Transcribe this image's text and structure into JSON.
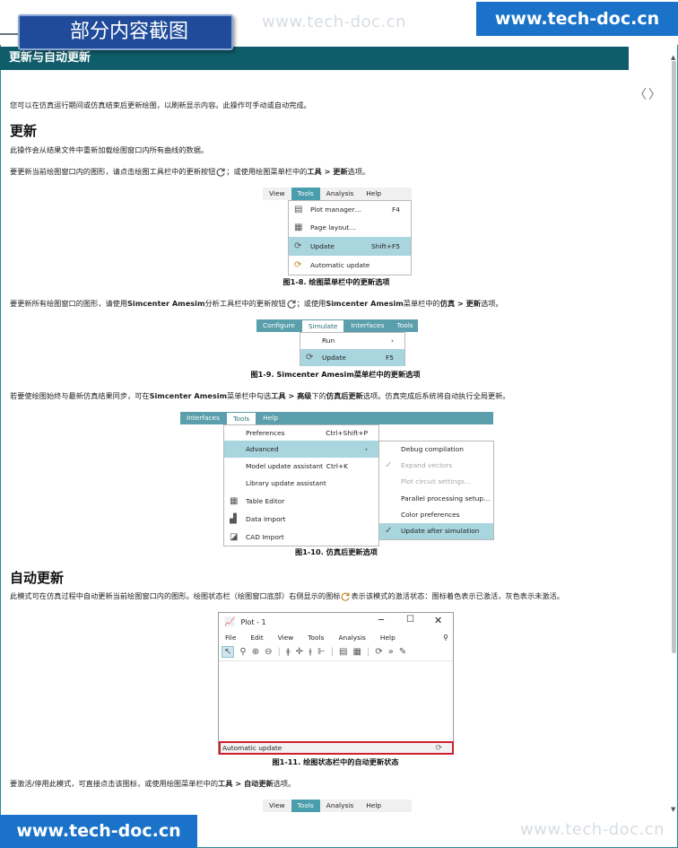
{
  "stub": {
    "title": "部分内容截图"
  },
  "watermark": "www.tech-doc.cn",
  "brand": "www.tech-doc.cn",
  "section": {
    "title": "更新与自动更新"
  },
  "nav": {
    "arrows": "〈〉"
  },
  "intro": "您可以在仿真运行期间或仿真结束后更新绘图，以刷新显示内容。此操作可手动或自动完成。",
  "update": {
    "heading": "更新",
    "p1": "此操作会从结果文件中重新加载绘图窗口内所有曲线的数据。",
    "p2_a": "要更新当前绘图窗口内的图形，请点击绘图工具栏中的更新按钮",
    "p2_b": "；或使用绘图菜单栏中的",
    "p2_c": "工具 > 更新",
    "p2_d": "选项。",
    "p3_a": "要更新所有绘图窗口的图形，请使用",
    "p3_b": "Simcenter Amesim",
    "p3_c": "分析工具栏中的更新按钮",
    "p3_d": "；或使用",
    "p3_e": "Simcenter Amesim",
    "p3_f": "菜单栏中的",
    "p3_g": "仿真 > 更新",
    "p3_h": "选项。",
    "p4_a": "若要使绘图始终与最新仿真结果同步，可在",
    "p4_b": "Simcenter Amesim",
    "p4_c": "菜单栏中勾选",
    "p4_d": "工具 > 高级",
    "p4_e": "下的",
    "p4_f": "仿真后更新",
    "p4_g": "选项。仿真完成后系统将自动执行全局更新。"
  },
  "fig8": {
    "caption": "图1-8. 绘图菜单栏中的更新选项",
    "menubar": [
      "View",
      "Tools",
      "Analysis",
      "Help"
    ],
    "items": [
      {
        "label": "Plot manager…",
        "shortcut": "F4",
        "icon": "plot-manager-icon"
      },
      {
        "label": "Page layout…",
        "shortcut": "",
        "icon": "grid-icon"
      },
      {
        "label": "Update",
        "shortcut": "Shift+F5",
        "icon": "refresh-icon"
      },
      {
        "label": "Automatic update",
        "shortcut": "",
        "icon": "auto-update-icon"
      }
    ]
  },
  "fig9": {
    "caption": "图1-9. Simcenter Amesim菜单栏中的更新选项",
    "menubar": [
      "Configure",
      "Simulate",
      "Interfaces",
      "Tools"
    ],
    "items": [
      {
        "label": "Run",
        "shortcut": "›"
      },
      {
        "label": "Update",
        "shortcut": "F5",
        "icon": "refresh-icon"
      }
    ]
  },
  "fig10": {
    "caption": "图1-10. 仿真后更新选项",
    "menubar": [
      "Interfaces",
      "Tools",
      "Help"
    ],
    "items": [
      {
        "label": "Preferences",
        "shortcut": "Ctrl+Shift+P"
      },
      {
        "label": "Advanced",
        "shortcut": "›"
      },
      {
        "label": "Model update assistant",
        "shortcut": "Ctrl+K"
      },
      {
        "label": "Library update assistant",
        "shortcut": ""
      },
      {
        "label": "Table Editor",
        "shortcut": "",
        "icon": "table-icon"
      },
      {
        "label": "Data Import",
        "shortcut": "",
        "icon": "data-import-icon"
      },
      {
        "label": "CAD Import",
        "shortcut": "",
        "icon": "cad-import-icon"
      }
    ],
    "submenu": [
      {
        "label": "Debug compilation"
      },
      {
        "label": "Expand vectors",
        "check": "✓"
      },
      {
        "label": "Plot circuit settings…"
      },
      {
        "label": "Parallel processing setup…"
      },
      {
        "label": "Color preferences"
      },
      {
        "label": "Update after simulation",
        "check": "✓"
      }
    ]
  },
  "auto": {
    "heading": "自动更新",
    "p1_a": "此模式可在仿真过程中自动更新当前绘图窗口内的图形。绘图状态栏（绘图窗口底部）右侧显示的图标",
    "p1_b": "表示该模式的激活状态：图标着色表示已激活，灰色表示未激活。",
    "p2_a": "要激活/停用此模式，可直接点击该图标，或使用绘图菜单栏中的",
    "p2_b": "工具 > 自动更新",
    "p2_c": "选项。"
  },
  "fig11": {
    "caption": "图1-11. 绘图状态栏中的自动更新状态",
    "window_title": "Plot - 1",
    "menubar": [
      "File",
      "Edit",
      "View",
      "Tools",
      "Analysis",
      "Help"
    ],
    "status": "Automatic update"
  },
  "fig12": {
    "menubar": [
      "View",
      "Tools",
      "Analysis",
      "Help"
    ]
  }
}
